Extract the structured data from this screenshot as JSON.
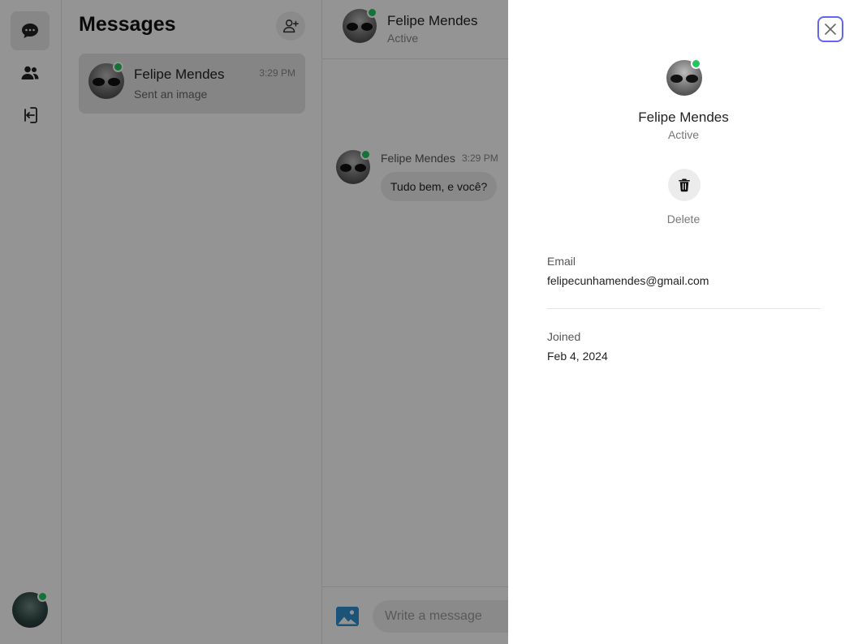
{
  "rail": {
    "items": [
      {
        "name": "messages",
        "icon": "chat-bubble-icon",
        "active": true
      },
      {
        "name": "contacts",
        "icon": "users-icon",
        "active": false
      },
      {
        "name": "logout",
        "icon": "logout-icon",
        "active": false
      }
    ],
    "user_online": true
  },
  "list": {
    "title": "Messages",
    "add_icon": "add-user-icon",
    "conversations": [
      {
        "name": "Felipe Mendes",
        "preview": "Sent an image",
        "time": "3:29 PM",
        "online": true
      }
    ]
  },
  "chat": {
    "header": {
      "name": "Felipe Mendes",
      "status": "Active"
    },
    "messages": [
      {
        "sender": "Felipe Mendes",
        "time": "3:29 PM",
        "text": "Tudo bem, e você?"
      }
    ],
    "composer": {
      "placeholder": "Write a message",
      "image_icon": "image-icon"
    }
  },
  "profile": {
    "name": "Felipe Mendes",
    "status": "Active",
    "delete_label": "Delete",
    "email_label": "Email",
    "email": "felipecunhamendes@gmail.com",
    "joined_label": "Joined",
    "joined": "Feb 4, 2024"
  },
  "colors": {
    "online": "#22c55e",
    "focus_ring": "#6366f1",
    "image_icon": "#2f8fd0"
  }
}
